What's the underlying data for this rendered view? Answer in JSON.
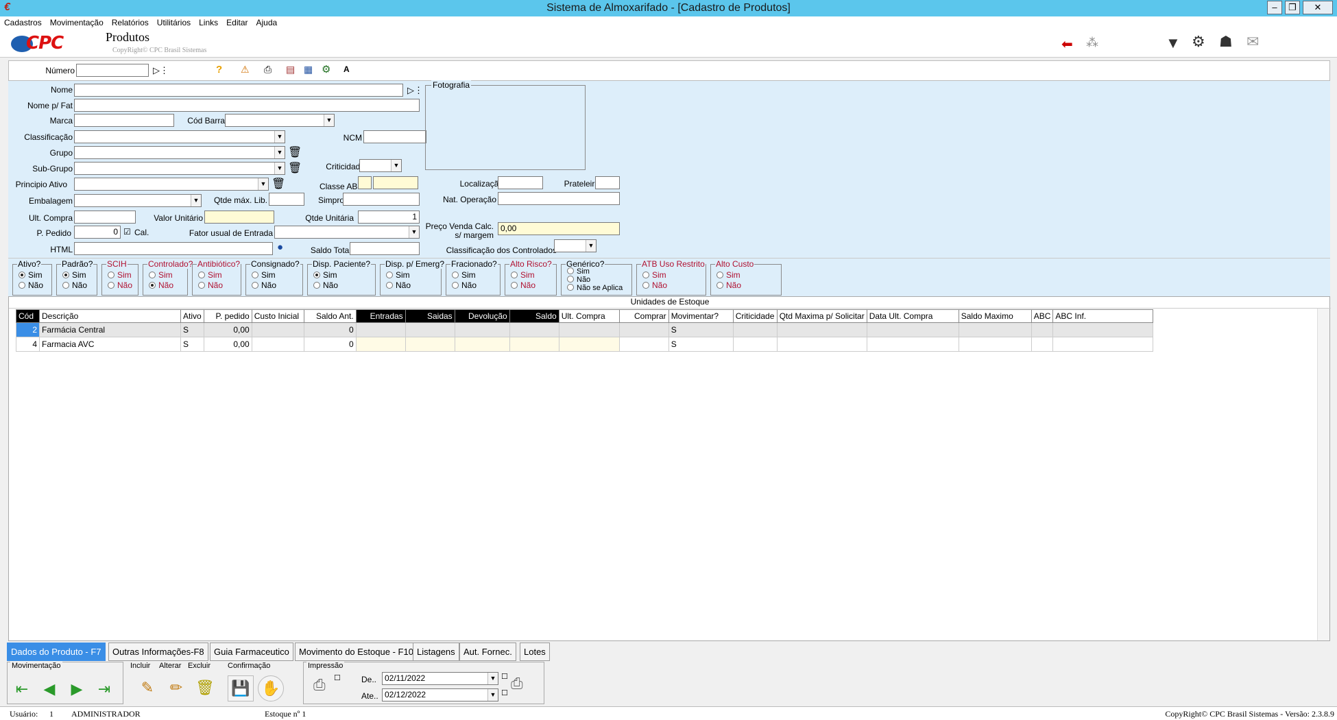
{
  "window": {
    "title": "Sistema de Almoxarifado - [Cadastro de Produtos]"
  },
  "menu": [
    "Cadastros",
    "Movimentação",
    "Relatórios",
    "Utilitários",
    "Links",
    "Editar",
    "Ajuda"
  ],
  "header": {
    "logo_text": "CPC",
    "title": "Produtos",
    "copyright": "CopyRight© CPC Brasil Sistemas"
  },
  "numrow": {
    "numero_label": "Número"
  },
  "form": {
    "nome": "Nome",
    "nome_fat": "Nome p/ Fat",
    "marca": "Marca",
    "cod_barra": "Cód Barra",
    "classificacao": "Classificação",
    "ncm": "NCM",
    "grupo": "Grupo",
    "subgrupo": "Sub-Grupo",
    "criticidade": "Criticidade",
    "principio": "Principio Ativo",
    "classe_abc": "Classe ABC",
    "localizacao": "Localização",
    "prateleira": "Prateleira",
    "embalagem": "Embalagem",
    "qtde_max_lib": "Qtde máx. Lib.",
    "simpro": "Simpro",
    "nat_operacao": "Nat. Operação",
    "ult_compra": "Ult. Compra",
    "valor_unitario": "Valor Unitário",
    "qtde_unitaria": "Qtde Unitária",
    "qtde_unitaria_value": "1",
    "preco_venda": "Preço Venda Calc.",
    "preco_venda2": "s/ margem",
    "preco_venda_value": "0,00",
    "p_pedido": "P. Pedido",
    "p_pedido_value": "0",
    "cal": "Cal.",
    "fator": "Fator usual de Entrada",
    "html": "HTML",
    "saldo_total": "Saldo Total",
    "class_controlados": "Classificação dos Controlados",
    "fotografia": "Fotografia"
  },
  "radio_groups": [
    {
      "label": "Ativo?",
      "red": false,
      "opts": [
        "Sim",
        "Não"
      ],
      "sel": 0
    },
    {
      "label": "Padrão?",
      "red": false,
      "opts": [
        "Sim",
        "Não"
      ],
      "sel": 0
    },
    {
      "label": "SCIH",
      "red": true,
      "opts": [
        "Sim",
        "Não"
      ],
      "sel": -1
    },
    {
      "label": "Controlado?",
      "red": true,
      "opts": [
        "Sim",
        "Não"
      ],
      "sel": 1
    },
    {
      "label": "Antibiótico?",
      "red": true,
      "opts": [
        "Sim",
        "Não"
      ],
      "sel": -1
    },
    {
      "label": "Consignado?",
      "red": false,
      "opts": [
        "Sim",
        "Não"
      ],
      "sel": -1
    },
    {
      "label": "Disp. Paciente?",
      "red": false,
      "opts": [
        "Sim",
        "Não"
      ],
      "sel": 0
    },
    {
      "label": "Disp. p/ Emerg?",
      "red": false,
      "opts": [
        "Sim",
        "Não"
      ],
      "sel": -1
    },
    {
      "label": "Fracionado?",
      "red": false,
      "opts": [
        "Sim",
        "Não"
      ],
      "sel": -1
    },
    {
      "label": "Alto Risco?",
      "red": true,
      "opts": [
        "Sim",
        "Não"
      ],
      "sel": -1
    },
    {
      "label": "Genérico?",
      "red": false,
      "opts": [
        "Sim",
        "Não",
        "Não se Aplica"
      ],
      "sel": -1
    },
    {
      "label": "ATB Uso Restrito",
      "red": true,
      "opts": [
        "Sim",
        "Não"
      ],
      "sel": -1
    },
    {
      "label": "Alto Custo",
      "red": true,
      "opts": [
        "Sim",
        "Não"
      ],
      "sel": -1
    }
  ],
  "grid": {
    "caption": "Unidades de Estoque",
    "headers": [
      "Cód",
      "Descrição",
      "Ativo",
      "P. pedido",
      "Custo Inicial",
      "Saldo Ant.",
      "Entradas",
      "Saidas",
      "Devolução",
      "Saldo",
      "Ult. Compra",
      "Comprar",
      "Movimentar?",
      "Criticidade",
      "Qtd Maxima p/ Solicitar",
      "Data Ult. Compra",
      "Saldo Maximo",
      "ABC",
      "ABC Inf."
    ],
    "rows": [
      [
        "2",
        "Farmácia Central",
        "S",
        "0,00",
        "",
        "0",
        "",
        "",
        "",
        "",
        "",
        "",
        "S",
        "",
        "",
        "",
        "",
        "",
        ""
      ],
      [
        "4",
        "Farmacia AVC",
        "S",
        "0,00",
        "",
        "0",
        "",
        "",
        "",
        "",
        "",
        "",
        "S",
        "",
        "",
        "",
        "",
        "",
        ""
      ]
    ]
  },
  "tabs": [
    "Dados do Produto - F7",
    "Outras Informações-F8",
    "Guia Farmaceutico",
    "Movimento do Estoque - F10",
    "Listagens",
    "Aut. Fornec.",
    "Lotes"
  ],
  "bottom": {
    "movimentacao": "Movimentação",
    "incluir": "Incluir",
    "alterar": "Alterar",
    "excluir": "Excluir",
    "confirmacao": "Confirmação",
    "impressao": "Impressão",
    "de": "De..",
    "ate": "Ate..",
    "de_date": "02/11/2022",
    "ate_date": "02/12/2022"
  },
  "status": {
    "usuario_label": "Usuário:",
    "usuario_id": "1",
    "usuario_name": "ADMINISTRADOR",
    "estoque": "Estoque nº 1",
    "copyright": "CopyRight© CPC Brasil Sistemas - Versão: 2.3.8.9"
  }
}
